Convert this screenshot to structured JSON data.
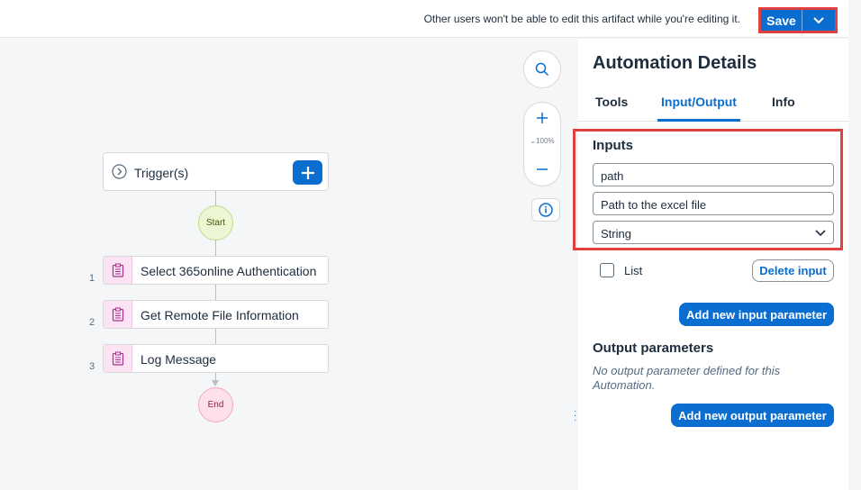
{
  "topbar": {
    "notice": "Other users won't be able to edit this artifact while you're editing it.",
    "save_label": "Save",
    "save_menu_icon": "chevron-down-icon"
  },
  "canvas": {
    "zoom_level": "100%",
    "trigger_label": "Trigger(s)",
    "start_label": "Start",
    "end_label": "End",
    "steps": [
      {
        "num": "1",
        "label": "Select 365online Authentication"
      },
      {
        "num": "2",
        "label": "Get Remote File Information"
      },
      {
        "num": "3",
        "label": "Log Message"
      }
    ]
  },
  "panel": {
    "title": "Automation Details",
    "tabs": [
      {
        "label": "Tools",
        "active": false
      },
      {
        "label": "Input/Output",
        "active": true
      },
      {
        "label": "Info",
        "active": false
      }
    ],
    "inputs": {
      "title": "Inputs",
      "name_value": "path",
      "description_value": "Path to the excel file",
      "type_value": "String",
      "list_label": "List",
      "list_checked": false,
      "delete_label": "Delete input",
      "add_label": "Add new input parameter"
    },
    "outputs": {
      "title": "Output parameters",
      "empty_note": "No output parameter defined for this Automation.",
      "add_label": "Add new output parameter"
    }
  },
  "colors": {
    "accent": "#0a6ed1",
    "highlight": "#e0403f",
    "start_node": "#eef5d2",
    "end_node": "#fde0ea",
    "step_icon_bg": "#fbe3f3"
  }
}
